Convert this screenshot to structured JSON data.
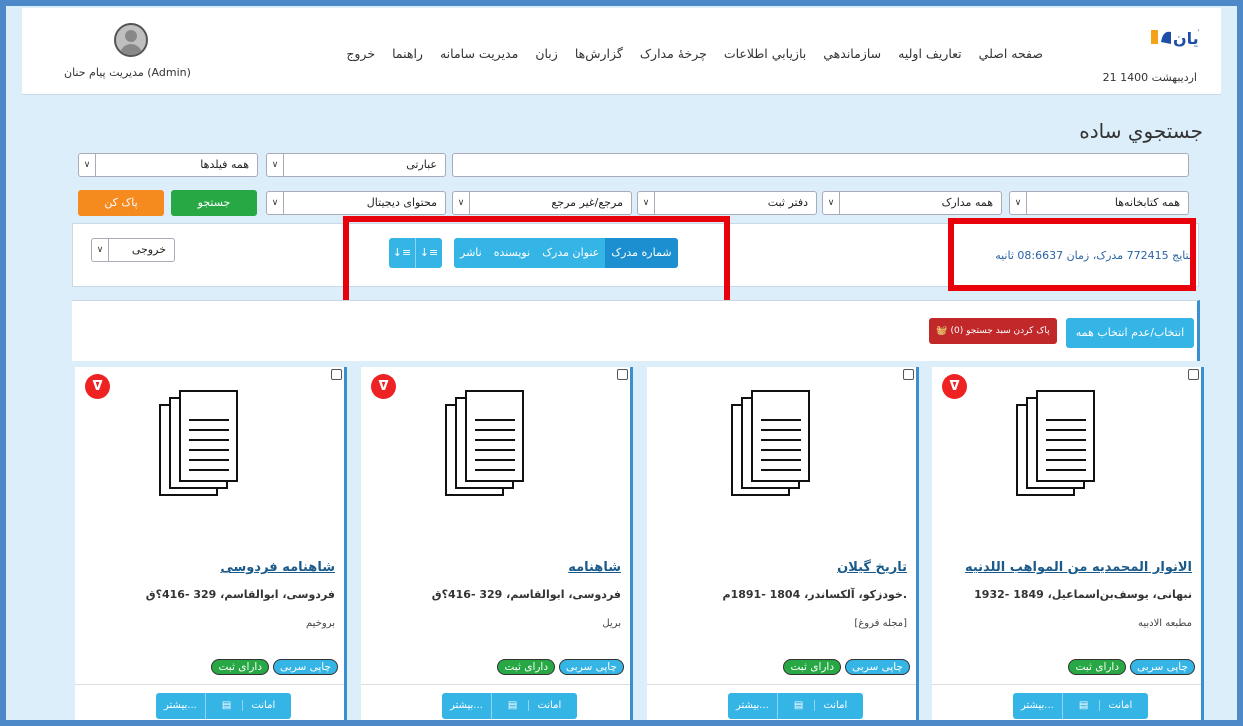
{
  "header": {
    "logo_text": "آیان",
    "date": "21 ارديبهشت 1400",
    "nav": [
      "صفحه اصلي",
      "تعاريف اوليه",
      "سازماندهي",
      "بازيابي اطلاعات",
      "چرخهٔ مدارک",
      "گزارش‌ها",
      "زبان",
      "مديريت سامانه",
      "راهنما",
      "خروج"
    ],
    "user": "مديريت پيام حنان (Admin)"
  },
  "page_title": "جستجوي ساده",
  "search": {
    "query_value": "",
    "type_select": "عبارتی",
    "field_select": "همه فیلدها",
    "library_select": "همه کتابخانه‌ها",
    "docs_select": "همه مدارک",
    "register_select": "دفتر ثبت",
    "reference_select": "مرجع/غیر مرجع",
    "digital_select": "محتوای دیجیتال",
    "search_button": "جستجو",
    "clear_button": "پاک کن"
  },
  "results": {
    "summary": "نتایج 772415 مدرک، زمان 08:6637 ثانیه",
    "sort_options": [
      "شماره مدرک",
      "عنوان مدرک",
      "نویسنده",
      "ناشر"
    ],
    "sort_active": "شماره مدرک",
    "order_desc": "↓≡",
    "order_asc": "↓≡",
    "output_select": "خروجی"
  },
  "selection": {
    "select_all": "انتخاب/عدم انتخاب همه",
    "clear_cart": "پاک کردن سبد جستجو (0)"
  },
  "cards": [
    {
      "title": "الانوار المحمديه من المواهب اللدنيه",
      "author": "نبهانی، يوسف‌بن‌اسماعيل، 1849 -1932",
      "publisher": "مطبعه الادبيه",
      "badge_print": "چاپی سربی",
      "badge_registered": "دارای ثبت",
      "btn_more": "بیشتر...",
      "btn_loan": "امانت",
      "has_pdf": true
    },
    {
      "title": "تاريخ گيلان",
      "author": "خودزکو، آلکساندر، 1804 -1891م.",
      "publisher": "[مجله فروغ]",
      "badge_print": "چاپی سربی",
      "badge_registered": "دارای ثبت",
      "btn_more": "بیشتر...",
      "btn_loan": "امانت",
      "has_pdf": false
    },
    {
      "title": "شاهنامه",
      "author": "فردوسی، ابوالقاسم، 329 -416؟ق",
      "publisher": "بريل",
      "badge_print": "چاپی سربی",
      "badge_registered": "دارای ثبت",
      "btn_more": "بیشتر...",
      "btn_loan": "امانت",
      "has_pdf": true
    },
    {
      "title": "شاهنامه فردوسی",
      "author": "فردوسی، ابوالقاسم، 329 -416؟ق",
      "publisher": "بروخيم",
      "badge_print": "چاپی سربی",
      "badge_registered": "دارای ثبت",
      "btn_more": "بیشتر...",
      "btn_loan": "امانت",
      "has_pdf": true
    }
  ],
  "colors": {
    "frame_bg": "#ddeefb",
    "border_blue": "#4d88c9",
    "accent_blue": "#35b4e6",
    "search_green": "#27a844",
    "clear_orange": "#f58a1f",
    "danger_red": "#c0282a",
    "highlight_red": "#e8000b"
  }
}
